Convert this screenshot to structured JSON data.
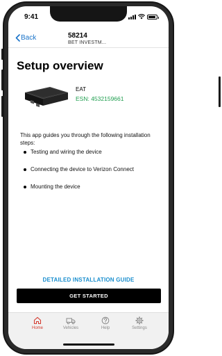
{
  "status_bar": {
    "time": "9:41"
  },
  "nav": {
    "back_label": "Back",
    "title": "58214",
    "subtitle": "BET INVESTM..."
  },
  "page": {
    "title": "Setup overview",
    "device_name": "EAT",
    "esn": "ESN: 4532159661",
    "intro": "This app guides you through the following installation steps:",
    "steps": [
      "Testing and wiring the device",
      "Connecting the device to Verizon Connect",
      "Mounting the device"
    ],
    "guide_link": "DETAILED INSTALLATION GUIDE",
    "start_button": "GET STARTED"
  },
  "tabbar": {
    "items": [
      {
        "label": "Home",
        "icon": "home-icon",
        "active": true
      },
      {
        "label": "Vehicles",
        "icon": "truck-icon",
        "active": false
      },
      {
        "label": "Help",
        "icon": "help-icon",
        "active": false
      },
      {
        "label": "Settings",
        "icon": "gear-icon",
        "active": false
      }
    ]
  },
  "colors": {
    "link": "#1b8fce",
    "esn": "#1f9e4f",
    "active_tab": "#d43b2f",
    "inactive_tab": "#8a8a8a"
  }
}
